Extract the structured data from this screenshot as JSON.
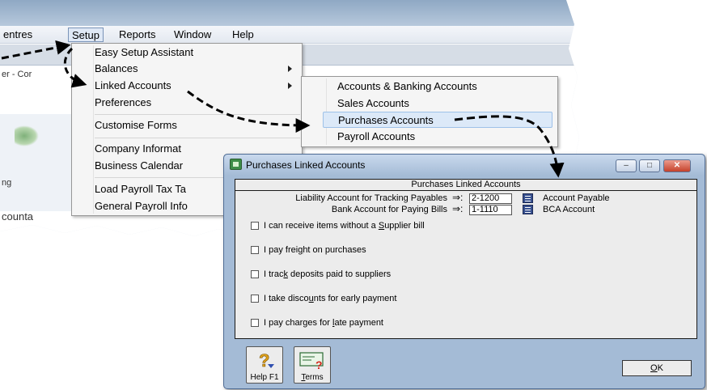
{
  "menubar": {
    "items": [
      "entres",
      "Setup",
      "Reports",
      "Window",
      "Help"
    ]
  },
  "background": {
    "fragment_window": "er - Cor",
    "fragment_label": "ng",
    "fragment_accounts": "counta"
  },
  "setup_menu": {
    "items": [
      "Easy Setup Assistant",
      "Balances",
      "Linked Accounts",
      "Preferences",
      "Customise Forms",
      "Company Informat",
      "Business Calendar",
      "Load Payroll Tax Ta",
      "General Payroll Info"
    ]
  },
  "linked_submenu": {
    "items": [
      "Accounts & Banking Accounts",
      "Sales Accounts",
      "Purchases Accounts",
      "Payroll Accounts"
    ]
  },
  "dialog": {
    "title": "Purchases Linked Accounts",
    "panel_heading": "Purchases Linked Accounts",
    "liability_label": "Liability Account for Tracking Payables",
    "liability_account": "2-1200",
    "liability_name": "Account Payable",
    "bank_label": "Bank Account for Paying Bills",
    "bank_account": "1-1110",
    "bank_name": "BCA Account",
    "checkboxes": [
      {
        "pre": "I can receive items without a ",
        "key": "S",
        "post": "upplier bill"
      },
      {
        "pre": "I pay frei",
        "key": "g",
        "post": "ht on purchases"
      },
      {
        "pre": "I trac",
        "key": "k",
        "post": " deposits paid to suppliers"
      },
      {
        "pre": "I take disco",
        "key": "u",
        "post": "nts for early payment"
      },
      {
        "pre": "I pay charges for ",
        "key": "l",
        "post": "ate payment"
      }
    ],
    "help_label": "Help F1",
    "terms_key": "T",
    "terms_rest": "erms",
    "ok_key": "O",
    "ok_rest": "K"
  },
  "colors": {
    "dialog_frame": "#a4bbd6",
    "panel": "#ececec",
    "close_button": "#c5412a"
  }
}
